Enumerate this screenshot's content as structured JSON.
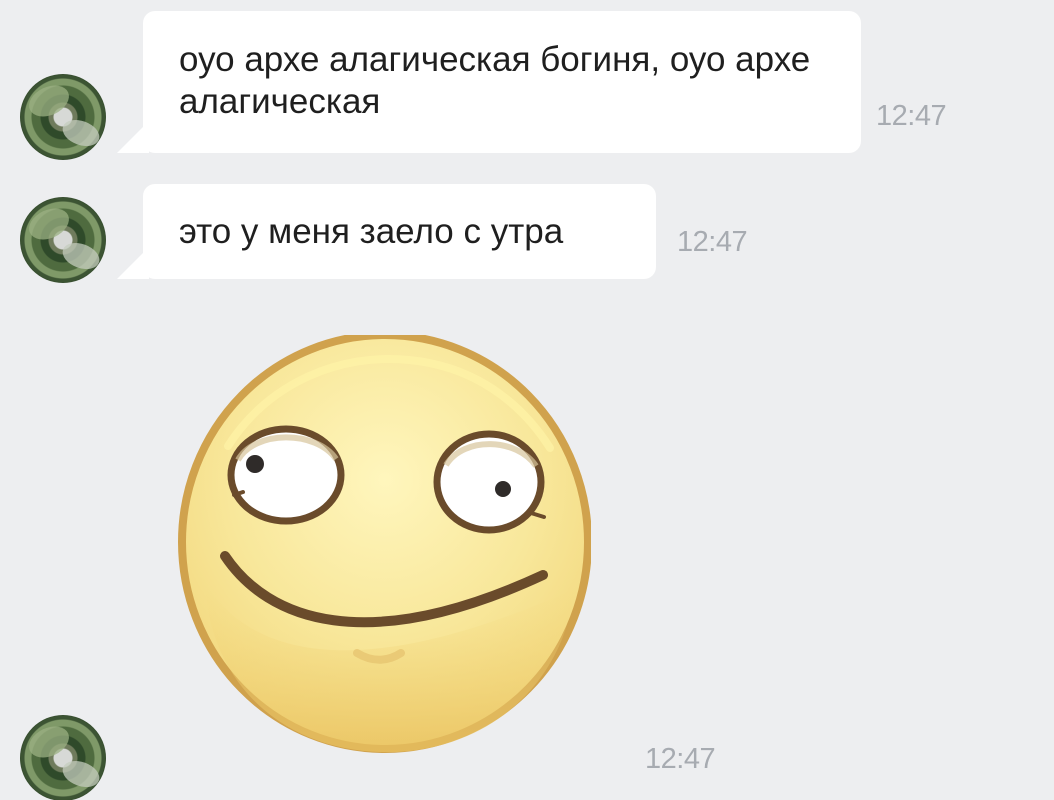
{
  "messages": [
    {
      "type": "text",
      "text": "оуо архе алагическая богиня, оуо архе алагическая",
      "time": "12:47"
    },
    {
      "type": "text",
      "text": "это у меня заело с утра",
      "time": "12:47"
    },
    {
      "type": "sticker",
      "sticker": "smiling-face-sticker",
      "time": "12:47"
    }
  ],
  "colors": {
    "background": "#edeef0",
    "bubble": "#ffffff",
    "text": "#1f1f1f",
    "time": "#a7abb1",
    "sticker_face": "#f8e79a",
    "sticker_outline": "#d0a24d",
    "sticker_features": "#6a4b2b"
  },
  "icons": {
    "avatar": "user-avatar-photo",
    "sticker": "smiling-face-sticker"
  }
}
